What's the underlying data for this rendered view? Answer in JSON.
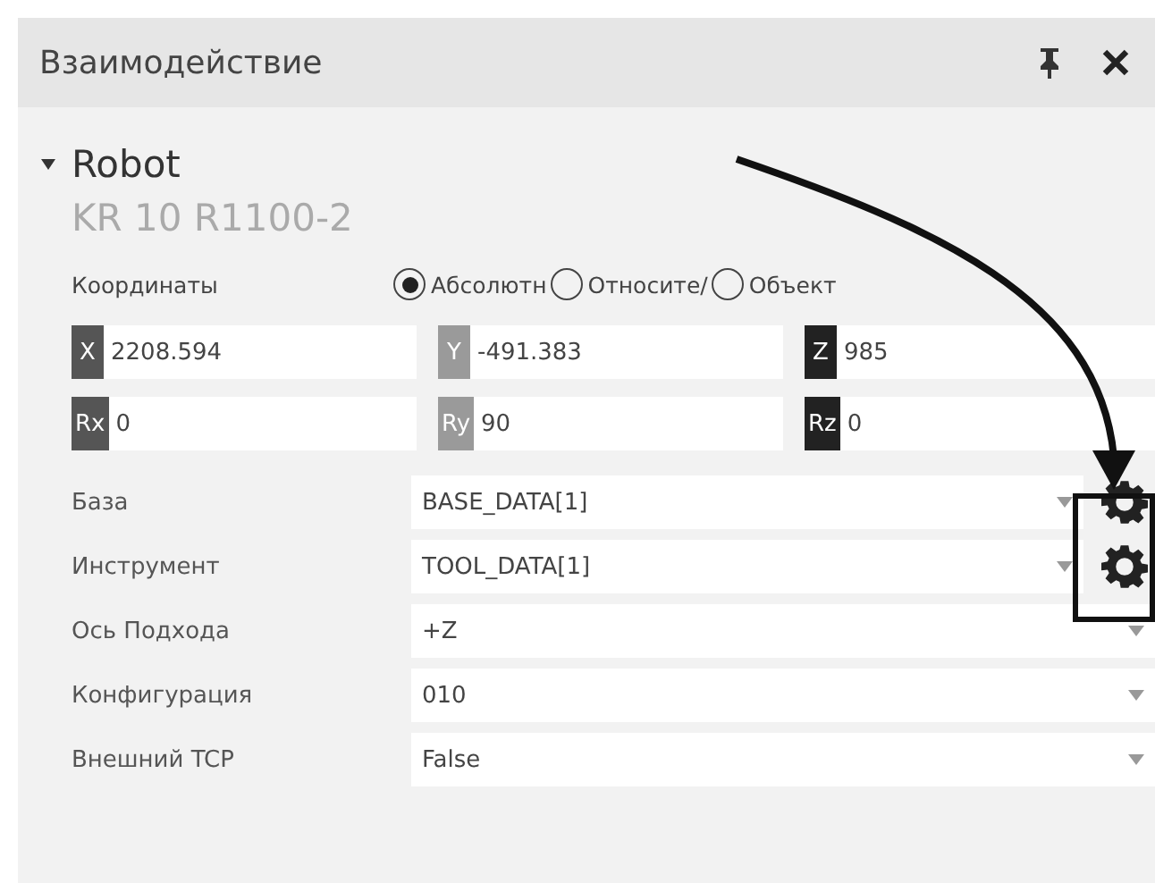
{
  "panel": {
    "title": "Взаимодействие"
  },
  "robot": {
    "name": "Robot",
    "expanded": true,
    "model": "KR 10 R1100-2"
  },
  "coordinates": {
    "label": "Координаты",
    "options": [
      {
        "label": "Абсолютн",
        "selected": true
      },
      {
        "label": "Относите/",
        "selected": false
      },
      {
        "label": "Объект",
        "selected": false
      }
    ]
  },
  "fields": [
    {
      "axis": "X",
      "value": "2208.594",
      "color": "#555555"
    },
    {
      "axis": "Y",
      "value": "-491.383",
      "color": "#9a9a9a"
    },
    {
      "axis": "Z",
      "value": "985",
      "color": "#222222"
    },
    {
      "axis": "Rx",
      "value": "0",
      "color": "#555555"
    },
    {
      "axis": "Ry",
      "value": "90",
      "color": "#9a9a9a"
    },
    {
      "axis": "Rz",
      "value": "0",
      "color": "#222222"
    }
  ],
  "settings": [
    {
      "label": "База",
      "value": "BASE_DATA[1]",
      "kind": "gear"
    },
    {
      "label": "Инструмент",
      "value": "TOOL_DATA[1]",
      "kind": "gear"
    },
    {
      "label": "Ось Подхода",
      "value": "+Z",
      "kind": "plain"
    },
    {
      "label": "Конфигурация",
      "value": "010",
      "kind": "plain"
    },
    {
      "label": "Внешний TCP",
      "value": "False",
      "kind": "plain"
    }
  ]
}
